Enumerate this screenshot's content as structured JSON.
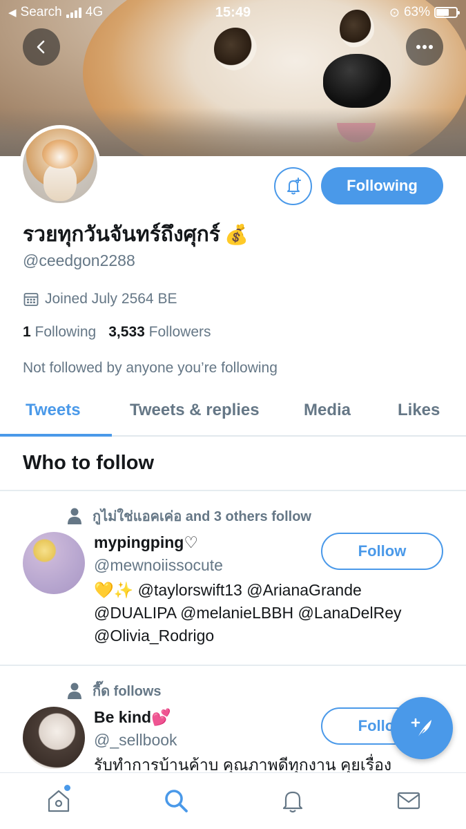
{
  "status_bar": {
    "back_app": "Search",
    "network": "4G",
    "time": "15:49",
    "battery": "63%",
    "battery_level": 0.63
  },
  "profile": {
    "display_name": "รวยทุกวันจันทร์ถึงศุกร์",
    "name_emoji": "💰",
    "handle": "@ceedgon2288",
    "joined": "Joined July 2564 BE",
    "following_count": "1",
    "following_label": "Following",
    "followers_count": "3,533",
    "followers_label": "Followers",
    "not_followed": "Not followed by anyone you’re following",
    "follow_state_label": "Following"
  },
  "tabs": [
    {
      "label": "Tweets",
      "active": true
    },
    {
      "label": "Tweets & replies",
      "active": false
    },
    {
      "label": "Media",
      "active": false
    },
    {
      "label": "Likes",
      "active": false
    }
  ],
  "who_to_follow": {
    "title": "Who to follow",
    "users": [
      {
        "social_context": "กูไม่ใช่แอคเค่อ and 3 others follow",
        "name": "mypingping♡",
        "handle": "@mewnoiissocute",
        "bio_line1": "💛✨ @taylorswift13 @ArianaGrande",
        "bio_line2": "@DUALIPA @melanieLBBH @LanaDelRey",
        "bio_line3": "@Olivia_Rodrigo",
        "button": "Follow"
      },
      {
        "social_context": "กี๊ด follows",
        "name": "Be kind💕",
        "handle": "@_sellbook",
        "bio_line1": "รับทำการบ้านค้าบ คุณภาพดีทุกงาน คุยเรื่อง",
        "button": "Follow"
      }
    ]
  },
  "colors": {
    "accent": "#4a99e9",
    "secondary_text": "#657786",
    "primary_text": "#14171a"
  },
  "icons": {
    "back": "chevron-left-icon",
    "more": "more-horizontal-icon",
    "bell": "bell-plus-icon",
    "calendar": "calendar-icon",
    "person": "person-icon",
    "compose": "compose-tweet-icon",
    "home": "home-icon",
    "search": "search-icon",
    "notifications": "bell-icon",
    "messages": "mail-icon"
  }
}
